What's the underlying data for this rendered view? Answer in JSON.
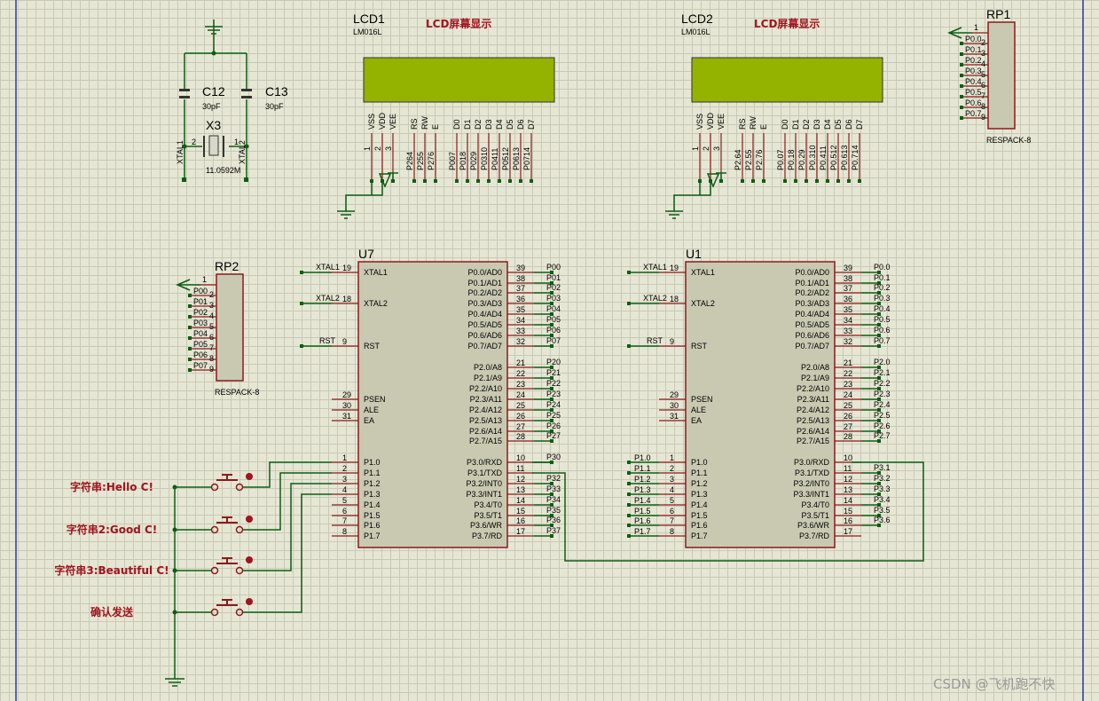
{
  "lcd1": {
    "ref": "LCD1",
    "model": "LM016L",
    "title": "LCD屏幕显示",
    "pins": [
      "VSS",
      "VDD",
      "VEE",
      "RS",
      "RW",
      "E",
      "D0",
      "D1",
      "D2",
      "D3",
      "D4",
      "D5",
      "D6",
      "D7"
    ],
    "nets": [
      "P264",
      "P255",
      "P276",
      "P007",
      "P018",
      "P029",
      "P0310",
      "P0411",
      "P0512",
      "P0613",
      "P0714"
    ]
  },
  "lcd2": {
    "ref": "LCD2",
    "model": "LM016L",
    "title": "LCD屏幕显示",
    "pins": [
      "VSS",
      "VDD",
      "VEE",
      "RS",
      "RW",
      "E",
      "D0",
      "D1",
      "D2",
      "D3",
      "D4",
      "D5",
      "D6",
      "D7"
    ],
    "nets": [
      "P2.64",
      "P2.55",
      "P2.76",
      "P0.07",
      "P0.18",
      "P0.29",
      "P0.310",
      "P0.411",
      "P0.512",
      "P0.613",
      "P0.714"
    ]
  },
  "rp1": {
    "ref": "RP1",
    "model": "RESPACK-8",
    "pin1": "1",
    "nets": [
      "P0.0",
      "P0.1",
      "P0.2",
      "P0.3",
      "P0.4",
      "P0.5",
      "P0.6",
      "P0.7"
    ],
    "nums": [
      "2",
      "3",
      "4",
      "5",
      "6",
      "7",
      "8",
      "9"
    ]
  },
  "rp2": {
    "ref": "RP2",
    "model": "RESPACK-8",
    "pin1": "1",
    "nets": [
      "P00",
      "P01",
      "P02",
      "P03",
      "P04",
      "P05",
      "P06",
      "P07"
    ],
    "nums": [
      "2",
      "3",
      "4",
      "5",
      "6",
      "7",
      "8",
      "9"
    ]
  },
  "osc": {
    "c12": "C12",
    "c12v": "30pF",
    "c13": "C13",
    "c13v": "30pF",
    "x3": "X3",
    "x3v": "11.0592M",
    "xtal1": "XTAL1",
    "xtal2": "XTAL2",
    "p2": "2",
    "p1": "1"
  },
  "u7": {
    "ref": "U7",
    "left": [
      [
        "XTAL1",
        "19"
      ],
      [
        "XTAL2",
        "18"
      ],
      [
        "RST",
        "9"
      ],
      [
        "PSEN",
        "29"
      ],
      [
        "ALE",
        "30"
      ],
      [
        "EA",
        "31"
      ],
      [
        "P1.0",
        "1"
      ],
      [
        "P1.1",
        "2"
      ],
      [
        "P1.2",
        "3"
      ],
      [
        "P1.3",
        "4"
      ],
      [
        "P1.4",
        "5"
      ],
      [
        "P1.5",
        "6"
      ],
      [
        "P1.6",
        "7"
      ],
      [
        "P1.7",
        "8"
      ]
    ],
    "right": [
      [
        "P0.0/AD0",
        "39"
      ],
      [
        "P0.1/AD1",
        "38"
      ],
      [
        "P0.2/AD2",
        "37"
      ],
      [
        "P0.3/AD3",
        "36"
      ],
      [
        "P0.4/AD4",
        "35"
      ],
      [
        "P0.5/AD5",
        "34"
      ],
      [
        "P0.6/AD6",
        "33"
      ],
      [
        "P0.7/AD7",
        "32"
      ],
      [
        "P2.0/A8",
        "21"
      ],
      [
        "P2.1/A9",
        "22"
      ],
      [
        "P2.2/A10",
        "23"
      ],
      [
        "P2.3/A11",
        "24"
      ],
      [
        "P2.4/A12",
        "25"
      ],
      [
        "P2.5/A13",
        "26"
      ],
      [
        "P2.6/A14",
        "27"
      ],
      [
        "P2.7/A15",
        "28"
      ],
      [
        "P3.0/RXD",
        "10"
      ],
      [
        "P3.1/TXD",
        "11"
      ],
      [
        "P3.2/INT0",
        "12"
      ],
      [
        "P3.3/INT1",
        "13"
      ],
      [
        "P3.4/T0",
        "14"
      ],
      [
        "P3.5/T1",
        "15"
      ],
      [
        "P3.6/WR",
        "16"
      ],
      [
        "P3.7/RD",
        "17"
      ]
    ],
    "lnets": [
      "XTAL1",
      "XTAL2",
      "RST"
    ],
    "rnets": [
      "P00",
      "P01",
      "P02",
      "P03",
      "P04",
      "P05",
      "P06",
      "P07",
      "P20",
      "P21",
      "P22",
      "P23",
      "P24",
      "P25",
      "P26",
      "P27",
      "P30",
      "",
      "P32",
      "P33",
      "P34",
      "P35",
      "P36",
      "P37"
    ]
  },
  "u1": {
    "ref": "U1",
    "left": [
      [
        "XTAL1",
        "19"
      ],
      [
        "XTAL2",
        "18"
      ],
      [
        "RST",
        "9"
      ],
      [
        "PSEN",
        "29"
      ],
      [
        "ALE",
        "30"
      ],
      [
        "EA",
        "31"
      ],
      [
        "P1.0",
        "1"
      ],
      [
        "P1.1",
        "2"
      ],
      [
        "P1.2",
        "3"
      ],
      [
        "P1.3",
        "4"
      ],
      [
        "P1.4",
        "5"
      ],
      [
        "P1.5",
        "6"
      ],
      [
        "P1.6",
        "7"
      ],
      [
        "P1.7",
        "8"
      ]
    ],
    "right": [
      [
        "P0.0/AD0",
        "39"
      ],
      [
        "P0.1/AD1",
        "38"
      ],
      [
        "P0.2/AD2",
        "37"
      ],
      [
        "P0.3/AD3",
        "36"
      ],
      [
        "P0.4/AD4",
        "35"
      ],
      [
        "P0.5/AD5",
        "34"
      ],
      [
        "P0.6/AD6",
        "33"
      ],
      [
        "P0.7/AD7",
        "32"
      ],
      [
        "P2.0/A8",
        "21"
      ],
      [
        "P2.1/A9",
        "22"
      ],
      [
        "P2.2/A10",
        "23"
      ],
      [
        "P2.3/A11",
        "24"
      ],
      [
        "P2.4/A12",
        "25"
      ],
      [
        "P2.5/A13",
        "26"
      ],
      [
        "P2.6/A14",
        "27"
      ],
      [
        "P2.7/A15",
        "28"
      ],
      [
        "P3.0/RXD",
        "10"
      ],
      [
        "P3.1/TXD",
        "11"
      ],
      [
        "P3.2/INT0",
        "12"
      ],
      [
        "P3.3/INT1",
        "13"
      ],
      [
        "P3.4/T0",
        "14"
      ],
      [
        "P3.5/T1",
        "15"
      ],
      [
        "P3.6/WR",
        "16"
      ],
      [
        "P3.7/RD",
        "17"
      ]
    ],
    "lnets": [
      "XTAL1",
      "XTAL2",
      "RST",
      "P1.0",
      "P1.1",
      "P1.2",
      "P1.3",
      "P1.4",
      "P1.5",
      "P1.6",
      "P1.7"
    ],
    "rnets": [
      "P0.0",
      "P0.1",
      "P0.2",
      "P0.3",
      "P0.4",
      "P0.5",
      "P0.6",
      "P0.7",
      "P2.0",
      "P2.1",
      "P2.2",
      "P2.3",
      "P2.4",
      "P2.5",
      "P2.6",
      "P2.7",
      "",
      "P3.1",
      "P3.2",
      "P3.3",
      "P3.4",
      "P3.5",
      "P3.6",
      ""
    ]
  },
  "buttons": [
    "字符串:Hello C!",
    "字符串2:Good C!",
    "字符串3:Beautiful C!",
    "确认发送"
  ],
  "watermark": "CSDN @飞机跑不快",
  "colors": {
    "wire": "#0b5e12",
    "chip_border": "#8b1a1a",
    "lcd": "#94b200",
    "label_red": "#a0141e",
    "grid": "#c9c9b6",
    "background": "#e6e6d4"
  }
}
